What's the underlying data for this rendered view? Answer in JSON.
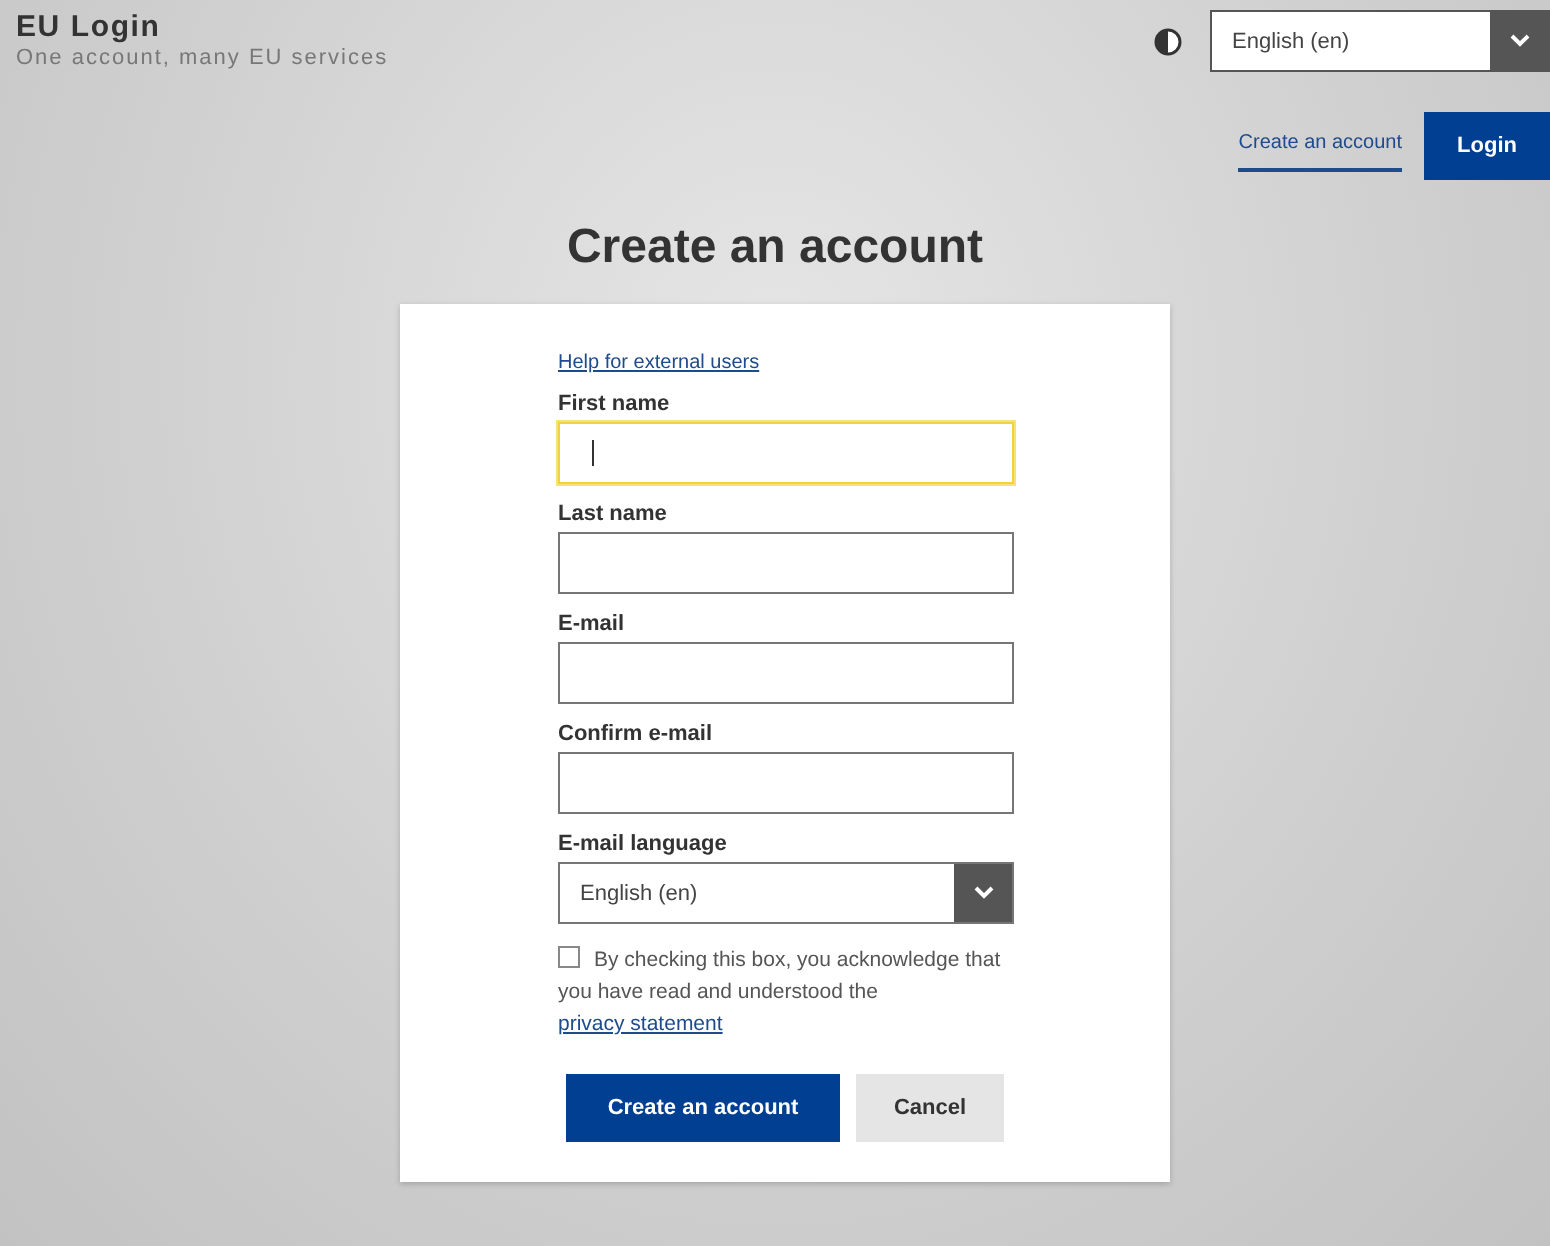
{
  "header": {
    "title": "EU Login",
    "subtitle": "One account, many EU services",
    "language": "English (en)"
  },
  "nav": [
    {
      "label": "Create an account",
      "kind": "link",
      "selected": true
    },
    {
      "label": "Login",
      "kind": "button",
      "selected": false
    }
  ],
  "page_title": "Create an account",
  "form": {
    "help_link": "Help for external users",
    "fields": [
      {
        "label": "First name",
        "kind": "text",
        "focused": true
      },
      {
        "label": "Last name",
        "kind": "text",
        "focused": false
      },
      {
        "label": "E-mail",
        "kind": "text",
        "focused": false
      },
      {
        "label": "Confirm e-mail",
        "kind": "text",
        "focused": false
      },
      {
        "label": "E-mail language",
        "kind": "select",
        "value": "English (en)",
        "focused": false
      }
    ],
    "consent": {
      "checked": false,
      "text": "By checking this box, you acknowledge that you have read and understood the ",
      "link": "privacy statement"
    },
    "buttons": [
      {
        "label": "Create an account",
        "kind": "primary"
      },
      {
        "label": "Cancel",
        "kind": "secondary"
      }
    ]
  }
}
